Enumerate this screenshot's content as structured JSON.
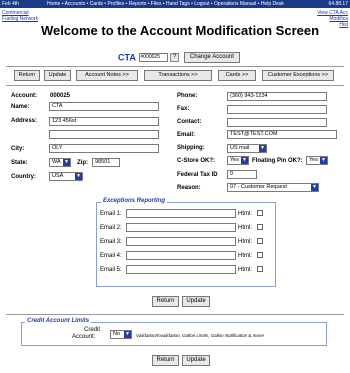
{
  "topbar": {
    "date": "Feb 4th",
    "nav": "Home • Accounts • Cards • Profiles • Reports • Files • Hand Tags • Logout • Operations Manual • Help Desk",
    "ip": "64.88.17"
  },
  "corp_link": "Commercial Fueling Network",
  "title": "Welcome to the Account Modification Screen",
  "right_links": {
    "line1": "View CTA Acc",
    "line2": "Modifica",
    "line3": "Hist"
  },
  "cta": {
    "label": "CTA",
    "value": "#000025",
    "help": "?",
    "change_button": "Change Account"
  },
  "buttons": {
    "return": "Return",
    "update": "Update",
    "account_notes": "Account Notes >>",
    "transactions": "Transactions >>",
    "cards": "Cards >>",
    "customer_exceptions": "Customer Exceptions >>"
  },
  "form": {
    "account_label": "Account:",
    "account_value": "000025",
    "name_label": "Name:",
    "name_value": "CTA",
    "address_label": "Address:",
    "address_value": "123 456st",
    "address2_value": "",
    "city_label": "City:",
    "city_value": "OLY",
    "state_label": "State:",
    "state_value": "WA",
    "zip_label": "Zip:",
    "zip_value": "98501",
    "country_label": "Country:",
    "country_value": "USA",
    "phone_label": "Phone:",
    "phone_value": "(360) 943-1234",
    "fax_label": "Fax:",
    "fax_value": "",
    "contact_label": "Contact:",
    "contact_value": "",
    "email_label": "Email:",
    "email_value": "TEST@TEST.COM",
    "shipping_label": "Shipping:",
    "shipping_value": "US mail",
    "cstore_label": "C-Store OK?:",
    "cstore_value": "Yes",
    "floating_label": "Floating Pin OK?:",
    "floating_value": "Yes",
    "fedtax_label": "Federal Tax ID",
    "fedtax_value": "0",
    "reason_label": "Reason:",
    "reason_value": "07 - Customer Request"
  },
  "exceptions": {
    "legend": "Exceptions Reporting",
    "html_label": "Html:",
    "emails": [
      {
        "label": "Email 1:",
        "value": ""
      },
      {
        "label": "Email 2:",
        "value": ""
      },
      {
        "label": "Email 3:",
        "value": ""
      },
      {
        "label": "Email 4:",
        "value": ""
      },
      {
        "label": "Email 5:",
        "value": ""
      }
    ]
  },
  "credit": {
    "legend": "Credit Account Limits",
    "label_line1": "Credit",
    "label_line2": "Account:",
    "value": "No",
    "note": "Validation/Invalidation, Gallon Limits, Gallon Notification & more!"
  }
}
